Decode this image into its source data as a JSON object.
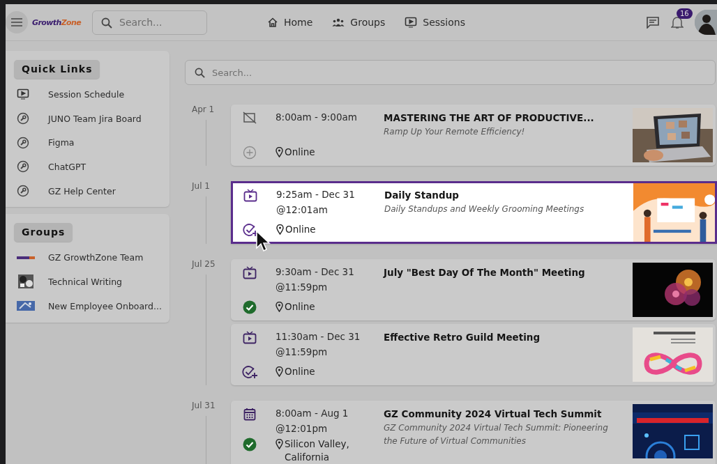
{
  "header": {
    "logo": {
      "part_1": "Growth",
      "part_2": "Zone"
    },
    "search": {
      "placeholder": "Search..."
    },
    "nav": [
      {
        "label": "Home"
      },
      {
        "label": "Groups"
      },
      {
        "label": "Sessions"
      }
    ],
    "notifications_count": "16"
  },
  "quick_links": {
    "title": "Quick Links",
    "items": [
      {
        "label": "Session Schedule",
        "kind": "session"
      },
      {
        "label": "JUNO Team Jira Board",
        "kind": "link"
      },
      {
        "label": "Figma",
        "kind": "link"
      },
      {
        "label": "ChatGPT",
        "kind": "link"
      },
      {
        "label": "GZ Help Center",
        "kind": "link"
      }
    ]
  },
  "groups": {
    "title": "Groups",
    "items": [
      {
        "label": "GZ GrowthZone Team"
      },
      {
        "label": "Technical Writing"
      },
      {
        "label": "New Employee Onboard..."
      }
    ]
  },
  "search": {
    "placeholder": "Search..."
  },
  "timeline": [
    {
      "date": "Apr 1",
      "sessions": [
        {
          "kind": "offline",
          "time": "8:00am - 9:00am",
          "location": "Online",
          "title": "MASTERING THE ART OF PRODUCTIVE...",
          "subtitle": "Ramp Up Your Remote Efficiency!",
          "registered": false,
          "can_register": false,
          "selected": false
        }
      ]
    },
    {
      "date": "Jul 1",
      "sessions": [
        {
          "kind": "stream",
          "time": "9:25am - Dec 31 @12:01am",
          "location": "Online",
          "title": "Daily Standup",
          "subtitle": "Daily Standups and Weekly Grooming Meetings",
          "registered": false,
          "can_register": true,
          "selected": true
        }
      ]
    },
    {
      "date": "Jul 25",
      "sessions": [
        {
          "kind": "stream",
          "time": "9:30am - Dec 31 @11:59pm",
          "location": "Online",
          "title": "July \"Best Day Of The Month\" Meeting",
          "registered": true,
          "selected": false
        },
        {
          "kind": "stream",
          "time": "11:30am - Dec 31 @11:59pm",
          "location": "Online",
          "title": "Effective Retro Guild Meeting",
          "registered": false,
          "can_register": true,
          "selected": false
        }
      ]
    },
    {
      "date": "Jul 31",
      "sessions": [
        {
          "kind": "event",
          "time": "8:00am - Aug 1 @12:01pm",
          "location": "Silicon Valley, California",
          "title": "GZ Community 2024 Virtual Tech Summit",
          "subtitle": "GZ Community 2024 Virtual Tech Summit: Pioneering the Future of Virtual Communities",
          "registered": true,
          "selected": false
        }
      ]
    }
  ]
}
